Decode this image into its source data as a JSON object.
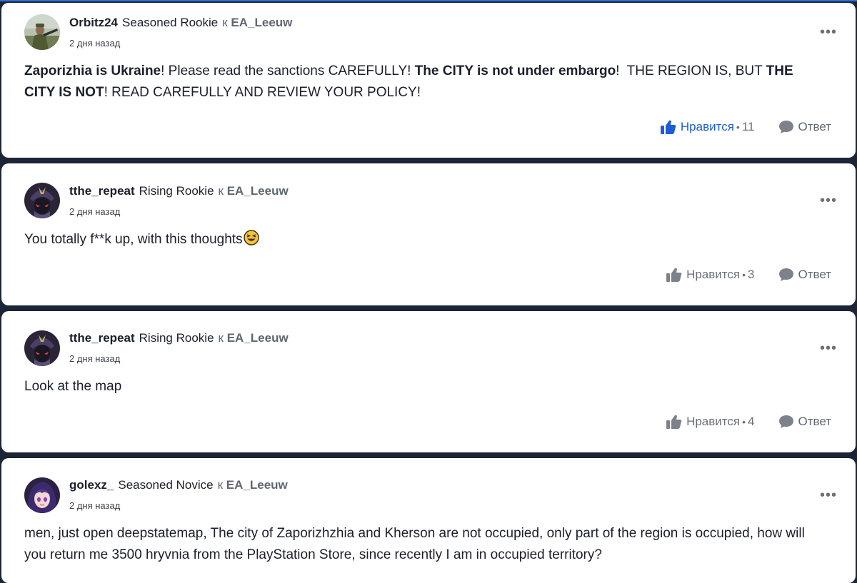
{
  "posts": [
    {
      "author": "Orbitz24",
      "rank": "Seasoned Rookie",
      "to_prefix": "к",
      "to_user": "EA_Leeuw",
      "time": "2 дня назад",
      "body": [
        {
          "t": "Zaporizhia is Ukraine",
          "b": true
        },
        {
          "t": "! Please read the sanctions CAREFULLY! ",
          "b": false
        },
        {
          "t": "The CITY is not under embargo",
          "b": true
        },
        {
          "t": "!  THE REGION IS, BUT ",
          "b": false
        },
        {
          "t": "THE CITY IS NOT",
          "b": true
        },
        {
          "t": "! READ CAREFULLY AND REVIEW YOUR POLICY!",
          "b": false
        }
      ],
      "like_label": "Нравится",
      "like_count": "11",
      "liked": true,
      "reply_label": "Ответ",
      "avatar_icon": "soldier-photo-avatar"
    },
    {
      "author": "tthe_repeat",
      "rank": "Rising Rookie",
      "to_prefix": "к",
      "to_user": "EA_Leeuw",
      "time": "2 дня назад",
      "body_text": "You totally f**k up, with this thoughts",
      "emoji": "laughing-face",
      "like_label": "Нравится",
      "like_count": "3",
      "liked": false,
      "reply_label": "Ответ",
      "avatar_icon": "samurai-avatar"
    },
    {
      "author": "tthe_repeat",
      "rank": "Rising Rookie",
      "to_prefix": "к",
      "to_user": "EA_Leeuw",
      "time": "2 дня назад",
      "body_text": "Look at the map",
      "like_label": "Нравится",
      "like_count": "4",
      "liked": false,
      "reply_label": "Ответ",
      "avatar_icon": "samurai-avatar"
    },
    {
      "author": "golexz_",
      "rank": "Seasoned Novice",
      "to_prefix": "к",
      "to_user": "EA_Leeuw",
      "time": "2 дня назад",
      "body_text": "men, just open deepstatemap, The city of Zaporizhzhia and Kherson are not occupied, only part of the region is occupied, how will you return me 3500 hryvnia from the PlayStation Store, since recently I am in occupied territory?",
      "avatar_icon": "anime-girl-avatar"
    }
  ],
  "colors": {
    "page_bg": "#1c2536",
    "card_bg": "#ffffff",
    "like_active": "#1e5bd6",
    "muted": "#6b7078"
  }
}
